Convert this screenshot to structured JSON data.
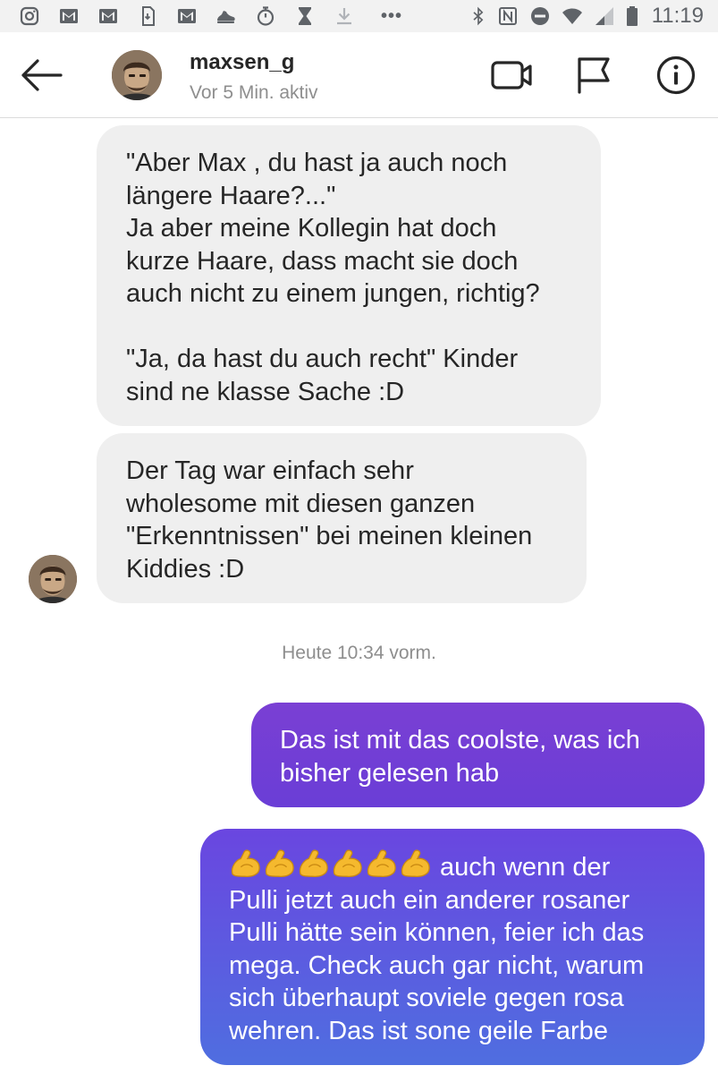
{
  "status_bar": {
    "time": "11:19",
    "left_icons": [
      "instagram-icon",
      "gmail-icon",
      "gmail-icon",
      "sim-icon",
      "gmail-icon",
      "shoe-icon",
      "stopwatch-icon",
      "hourglass-icon",
      "download-icon"
    ],
    "more": "•••",
    "right_icons": [
      "bluetooth-icon",
      "nfc-icon",
      "do-not-disturb-icon",
      "wifi-icon",
      "signal-icon",
      "battery-icon"
    ]
  },
  "header": {
    "username": "maxsen_g",
    "activity": "Vor 5 Min. aktiv",
    "icons": [
      "back-arrow-icon",
      "video-call-icon",
      "flag-icon",
      "info-icon"
    ]
  },
  "messages": [
    {
      "direction": "incoming",
      "text": "\"Aber Max , du hast ja auch noch\nlängere Haare?...\"\nJa aber meine Kollegin hat doch\nkurze Haare, dass macht sie doch\nauch nicht zu einem jungen, richtig?\n\n\"Ja, da hast du auch recht\" Kinder\nsind ne klasse Sache :D"
    },
    {
      "direction": "incoming",
      "text": "Der Tag war einfach sehr\nwholesome mit diesen ganzen\n\"Erkenntnissen\" bei meinen kleinen\nKiddies :D"
    },
    {
      "direction": "outgoing",
      "text": "Das ist mit das coolste, was ich\nbisher gelesen hab"
    },
    {
      "direction": "outgoing",
      "emoji": "💪💪💪💪💪💪",
      "text_after_emoji": "auch wenn der",
      "text": "Pulli jetzt auch ein anderer rosaner\nPulli hätte sein können, feier ich das\nmega. Check auch gar nicht, warum\nsich überhaupt soviele gegen rosa\nwehren. Das ist sone geile Farbe"
    }
  ],
  "timestamp": "Heute 10:34 vorm.",
  "colors": {
    "incoming_bubble": "#efefef",
    "outgoing_gradient_top": "#7a3fd4",
    "outgoing_gradient_bottom": "#4f6ee0",
    "muted_text": "#8e8e8e"
  }
}
